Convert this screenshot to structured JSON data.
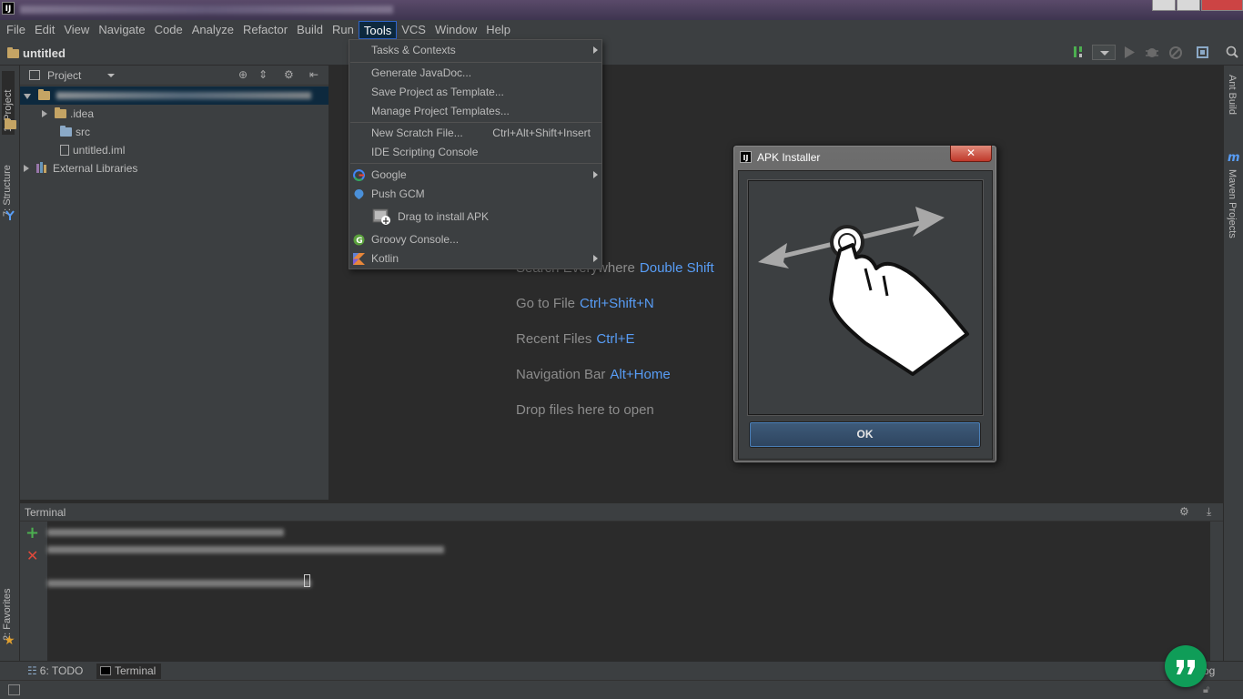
{
  "window": {
    "app_logo": "IJ"
  },
  "menubar": {
    "items": [
      "File",
      "Edit",
      "View",
      "Navigate",
      "Code",
      "Analyze",
      "Refactor",
      "Build",
      "Run",
      "Tools",
      "VCS",
      "Window",
      "Help"
    ],
    "active": "Tools"
  },
  "navbar": {
    "breadcrumb": "untitled"
  },
  "left_toolbar": {
    "project_tab": "1: Project",
    "structure_tab": "7: Structure",
    "favorites_tab": "2: Favorites"
  },
  "right_toolbar": {
    "ant_tab": "Ant Build",
    "maven_tab": "Maven Projects",
    "maven_icon": "m"
  },
  "project_panel": {
    "view_selector": "Project",
    "tree": [
      {
        "label": ".idea",
        "type": "folder"
      },
      {
        "label": "src",
        "type": "folder"
      },
      {
        "label": "untitled.iml",
        "type": "file"
      },
      {
        "label": "External Libraries",
        "type": "library"
      }
    ]
  },
  "editor_hints": [
    {
      "label": "Search Everywhere",
      "key": "Double Shift"
    },
    {
      "label": "Go to File",
      "key": "Ctrl+Shift+N"
    },
    {
      "label": "Recent Files",
      "key": "Ctrl+E"
    },
    {
      "label": "Navigation Bar",
      "key": "Alt+Home"
    },
    {
      "label": "Drop files here to open",
      "key": ""
    }
  ],
  "tools_menu": {
    "items": [
      {
        "label": "Tasks & Contexts",
        "shortcut": "",
        "submenu": true,
        "icon": ""
      },
      {
        "label": "Generate JavaDoc...",
        "shortcut": "",
        "submenu": false,
        "icon": ""
      },
      {
        "label": "Save Project as Template...",
        "shortcut": "",
        "submenu": false,
        "icon": ""
      },
      {
        "label": "Manage Project Templates...",
        "shortcut": "",
        "submenu": false,
        "icon": ""
      },
      {
        "label": "New Scratch File...",
        "shortcut": "Ctrl+Alt+Shift+Insert",
        "submenu": false,
        "icon": ""
      },
      {
        "label": "IDE Scripting Console",
        "shortcut": "",
        "submenu": false,
        "icon": ""
      },
      {
        "label": "Google",
        "shortcut": "",
        "submenu": true,
        "icon": "google-icon"
      },
      {
        "label": "Push GCM",
        "shortcut": "",
        "submenu": false,
        "icon": "gcm-icon"
      },
      {
        "label": "Drag to install APK",
        "shortcut": "",
        "submenu": false,
        "icon": "apk-drag-icon"
      },
      {
        "label": "Groovy Console...",
        "shortcut": "",
        "submenu": false,
        "icon": "groovy-icon"
      },
      {
        "label": "Kotlin",
        "shortcut": "",
        "submenu": true,
        "icon": "kotlin-icon"
      }
    ]
  },
  "apk_dialog": {
    "title": "APK Installer",
    "close_glyph": "✕",
    "ok_label": "OK",
    "illustration": "swipe-hand-icon"
  },
  "terminal": {
    "title": "Terminal"
  },
  "bottom_tabs": {
    "todo": "6: TODO",
    "terminal": "Terminal",
    "event_log_partial": "og"
  },
  "colors": {
    "accent": "#589df6",
    "menu_highlight": "#0d293e",
    "hangouts": "#0f9d58"
  }
}
